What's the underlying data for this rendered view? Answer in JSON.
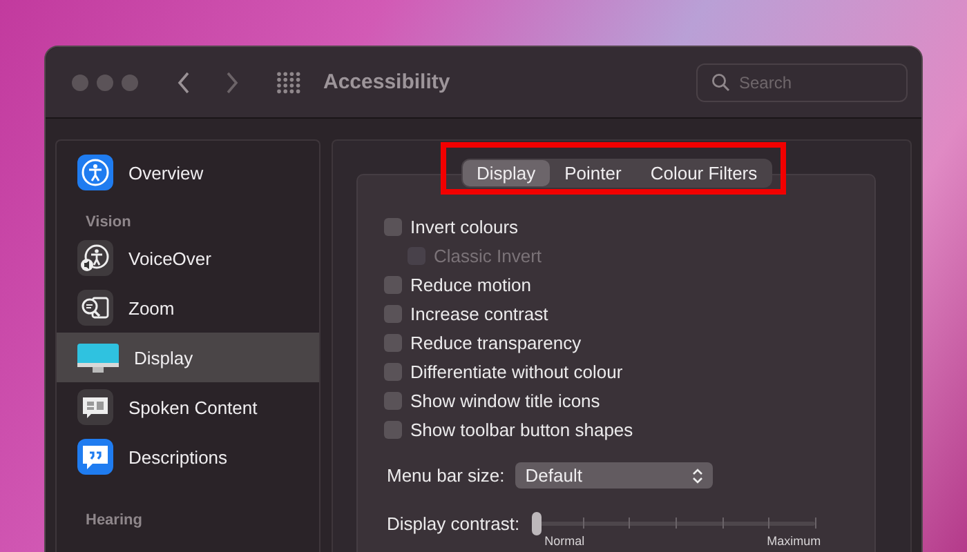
{
  "window": {
    "title": "Accessibility"
  },
  "search": {
    "placeholder": "Search"
  },
  "sidebar": {
    "sections": [
      {
        "items": [
          {
            "label": "Overview",
            "kind": "overview",
            "selected": false
          }
        ]
      },
      {
        "heading": "Vision",
        "items": [
          {
            "label": "VoiceOver",
            "kind": "voiceover",
            "selected": false
          },
          {
            "label": "Zoom",
            "kind": "zoom",
            "selected": false
          },
          {
            "label": "Display",
            "kind": "display",
            "selected": true
          },
          {
            "label": "Spoken Content",
            "kind": "spoken",
            "selected": false
          },
          {
            "label": "Descriptions",
            "kind": "descriptions",
            "selected": false
          }
        ]
      },
      {
        "heading": "Hearing"
      }
    ]
  },
  "tabs": [
    {
      "label": "Display",
      "selected": true
    },
    {
      "label": "Pointer",
      "selected": false
    },
    {
      "label": "Colour Filters",
      "selected": false
    }
  ],
  "options": [
    {
      "label": "Invert colours",
      "checked": false,
      "disabled": false,
      "children": [
        {
          "label": "Classic Invert",
          "checked": false,
          "disabled": true
        }
      ]
    },
    {
      "label": "Reduce motion",
      "checked": false,
      "disabled": false
    },
    {
      "label": "Increase contrast",
      "checked": false,
      "disabled": false
    },
    {
      "label": "Reduce transparency",
      "checked": false,
      "disabled": false
    },
    {
      "label": "Differentiate without colour",
      "checked": false,
      "disabled": false
    },
    {
      "label": "Show window title icons",
      "checked": false,
      "disabled": false
    },
    {
      "label": "Show toolbar button shapes",
      "checked": false,
      "disabled": false
    }
  ],
  "menu_bar_size": {
    "label": "Menu bar size:",
    "value": "Default"
  },
  "display_contrast": {
    "label": "Display contrast:",
    "level": 0,
    "min_label": "Normal",
    "max_label": "Maximum"
  }
}
